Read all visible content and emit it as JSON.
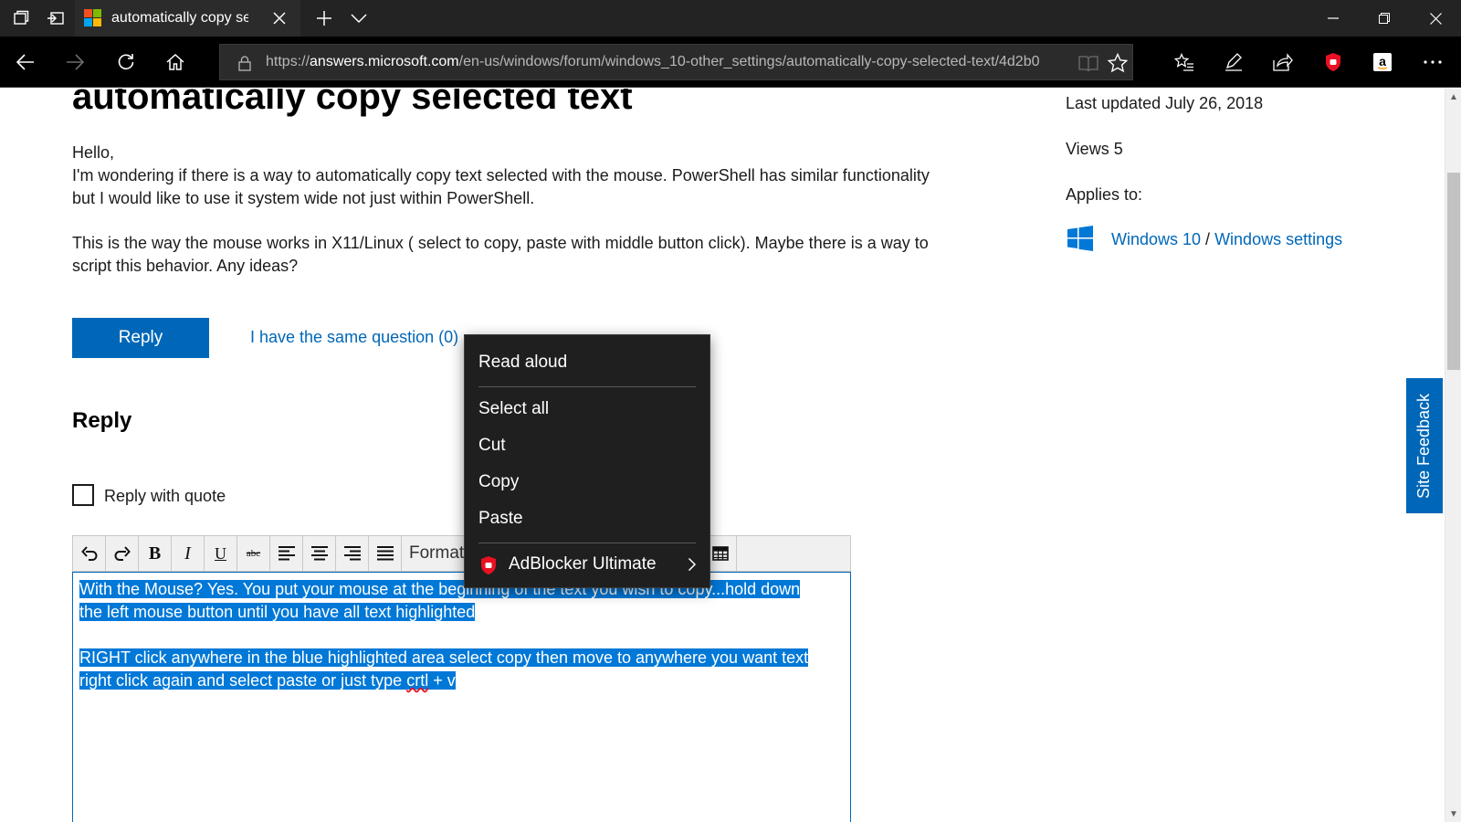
{
  "browser": {
    "tab_title": "automatically copy selected text",
    "url_prefix": "https://",
    "url_domain": "answers.microsoft.com",
    "url_path": "/en-us/windows/forum/windows_10-other_settings/automatically-copy-selected-text/4d2b0"
  },
  "post": {
    "title": "automatically copy selected text",
    "greeting": "Hello,",
    "paragraph1": "I'm wondering if there is a way to automatically copy text selected with the mouse. PowerShell has similar functionality but I would like to use it system wide not just within PowerShell.",
    "paragraph2": "This is the way the mouse works in X11/Linux ( select to copy, paste with middle button click). Maybe there is a way to script this behavior. Any ideas?",
    "reply_button": "Reply",
    "same_question": "I have the same question (0)"
  },
  "reply_section": {
    "heading": "Reply",
    "quote_label": "Reply with quote",
    "format_label": "Format",
    "editor_line1": "With the Mouse?  Yes. You put your mouse at the beginning of the text you wish to copy...hold down",
    "editor_line2": "the left mouse button until you have all text highlighted",
    "editor_line3": "RIGHT click anywhere in the blue highlighted area select copy then move to anywhere you want text",
    "editor_line4a": "right click again and select paste or just type ",
    "editor_line4b": "crtl",
    "editor_line4c": " + v"
  },
  "sidebar": {
    "last_updated": "Last updated July 26, 2018",
    "views": "Views 5",
    "applies_to": "Applies to:",
    "product": "Windows 10",
    "separator": " / ",
    "category": "Windows settings"
  },
  "feedback": "Site Feedback",
  "context_menu": {
    "items": [
      "Read aloud",
      "Select all",
      "Cut",
      "Copy",
      "Paste"
    ],
    "extension": "AdBlocker Ultimate"
  },
  "colors": {
    "accent": "#0067b8",
    "selection": "#0078d7",
    "adblock_red": "#e81123"
  }
}
